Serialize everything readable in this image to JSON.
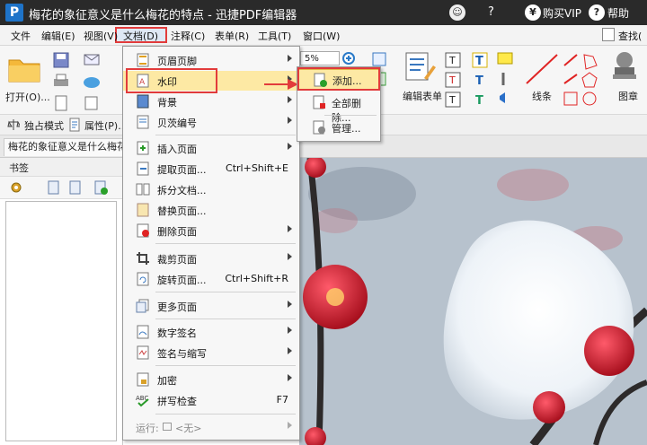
{
  "window": {
    "title": "梅花的象征意义是什么梅花的特点 - 迅捷PDF编辑器",
    "logo_letter": "P",
    "help_mark": "?",
    "vip_symbol": "¥",
    "vip_label": "购买VIP",
    "help_symbol": "?",
    "help_label": "帮助"
  },
  "menubar": {
    "file": "文件",
    "edit": "编辑(E)",
    "view": "视图(V)",
    "document": "文档(D)",
    "comment": "注释(C)",
    "form": "表单(R)",
    "tools": "工具(T)",
    "window": "窗口(W)",
    "find": "查找("
  },
  "toolbar": {
    "open_label": "打开(O)...",
    "zoom_value": "5%",
    "edit_form_label": "编辑表单",
    "line_label": "线条",
    "stamp_label": "图章",
    "exclusive_mode": "独占模式",
    "properties": "属性(P)..."
  },
  "tab": {
    "doc_title": "梅花的象征意义是什么梅花的"
  },
  "sidepanel": {
    "header": "书签"
  },
  "doc_menu": {
    "items": [
      {
        "label": "页眉页脚",
        "shortcut": "",
        "submenu": true
      },
      {
        "label": "水印",
        "shortcut": "",
        "submenu": true
      },
      {
        "label": "背景",
        "shortcut": "",
        "submenu": true
      },
      {
        "label": "贝茨编号",
        "shortcut": "",
        "submenu": true
      },
      {
        "label": "插入页面",
        "shortcut": "",
        "submenu": true
      },
      {
        "label": "提取页面...",
        "shortcut": "Ctrl+Shift+E",
        "submenu": false
      },
      {
        "label": "拆分文档...",
        "shortcut": "",
        "submenu": false
      },
      {
        "label": "替换页面...",
        "shortcut": "",
        "submenu": false
      },
      {
        "label": "删除页面",
        "shortcut": "",
        "submenu": true
      },
      {
        "label": "裁剪页面",
        "shortcut": "",
        "submenu": true
      },
      {
        "label": "旋转页面...",
        "shortcut": "Ctrl+Shift+R",
        "submenu": false
      },
      {
        "label": "更多页面",
        "shortcut": "",
        "submenu": true
      },
      {
        "label": "数字签名",
        "shortcut": "",
        "submenu": true
      },
      {
        "label": "签名与缩写",
        "shortcut": "",
        "submenu": true
      },
      {
        "label": "加密",
        "shortcut": "",
        "submenu": true
      },
      {
        "label": "拼写检查",
        "shortcut": "F7",
        "submenu": false
      },
      {
        "label": "运行:",
        "shortcut": "",
        "submenu": true
      }
    ],
    "run_value": "<无>",
    "spell_icon_text": "ABC"
  },
  "watermark_submenu": {
    "add": "添加...",
    "remove_all": "全部删除...",
    "manage": "管理..."
  },
  "colors": {
    "highlight": "#fde9a4",
    "annotation_red": "#e23b3b",
    "title_bar": "#2a2a2a"
  }
}
